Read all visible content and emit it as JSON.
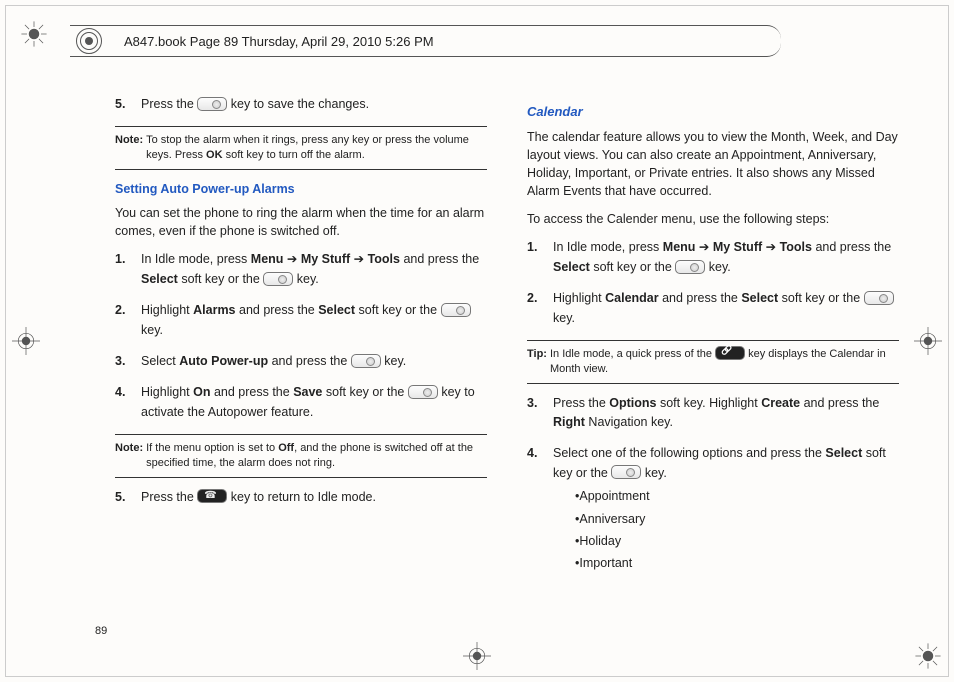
{
  "header": {
    "text": "A847.book  Page 89  Thursday, April 29, 2010  5:26 PM"
  },
  "page_number": "89",
  "left": {
    "step5_top": {
      "num": "5.",
      "pre": "Press the ",
      "post": " key to save the changes."
    },
    "note1": {
      "label": "Note:",
      "body_a": "To stop the alarm when it rings, press any key or press the volume keys. Press ",
      "bold": "OK",
      "body_b": " soft key to turn off the alarm."
    },
    "sec_heading": "Setting Auto Power-up Alarms",
    "intro": "You can set the phone to ring the alarm when the time for an alarm comes, even if the phone is switched off.",
    "steps": {
      "s1": {
        "num": "1.",
        "a": "In Idle mode, press ",
        "b1": "Menu",
        "arr1": " ➔ ",
        "b2": "My Stuff",
        "arr2": " ➔ ",
        "b3": "Tools",
        "c": " and press the ",
        "b4": "Select",
        "d": " soft key or the ",
        "e": " key."
      },
      "s2": {
        "num": "2.",
        "a": "Highlight ",
        "b1": "Alarms",
        "c": " and press the ",
        "b2": "Select",
        "d": " soft key or the ",
        "e": " key."
      },
      "s3": {
        "num": "3.",
        "a": "Select ",
        "b1": "Auto Power-up",
        "c": " and press the ",
        "e": " key."
      },
      "s4": {
        "num": "4.",
        "a": "Highlight ",
        "b1": "On",
        "c": " and press the ",
        "b2": "Save",
        "d": " soft key or the ",
        "e": " key to activate the Autopower feature."
      }
    },
    "note2": {
      "label": "Note:",
      "body_a": "If the menu option is set to ",
      "bold": "Off",
      "body_b": ", and the phone is switched off at the specified time, the alarm does not ring."
    },
    "step5_bottom": {
      "num": "5.",
      "pre": "Press the ",
      "post": " key to return to Idle mode."
    }
  },
  "right": {
    "sec_heading": "Calendar",
    "p1": "The calendar feature allows you to view the Month, Week, and Day layout views. You can also create an Appointment, Anniversary, Holiday, Important, or Private entries. It also shows any Missed Alarm Events that have occurred.",
    "p2": "To access the Calender menu, use the following steps:",
    "steps12": {
      "s1": {
        "num": "1.",
        "a": "In Idle mode, press ",
        "b1": "Menu",
        "arr1": " ➔ ",
        "b2": "My Stuff",
        "arr2": " ➔ ",
        "b3": "Tools",
        "c": " and press the ",
        "b4": "Select",
        "d": " soft key or the ",
        "e": " key."
      },
      "s2": {
        "num": "2.",
        "a": "Highlight ",
        "b1": "Calendar",
        "c": " and press the ",
        "b2": "Select",
        "d": " soft key or the ",
        "e": " key."
      }
    },
    "tip": {
      "label": "Tip:",
      "body_a": " In Idle mode, a quick press of the ",
      "body_b": " key displays the Calendar in Month view."
    },
    "steps34": {
      "s3": {
        "num": "3.",
        "a": "Press the ",
        "b1": "Options",
        "c": " soft key. Highlight ",
        "b2": "Create",
        "d": " and press the ",
        "b3": "Right",
        "e": " Navigation key."
      },
      "s4": {
        "num": "4.",
        "a": "Select one of the following options and press the ",
        "b1": "Select",
        "c": " soft key or the ",
        "e": " key."
      }
    },
    "bullets": {
      "b1": "Appointment",
      "b2": "Anniversary",
      "b3": "Holiday",
      "b4": "Important"
    }
  }
}
